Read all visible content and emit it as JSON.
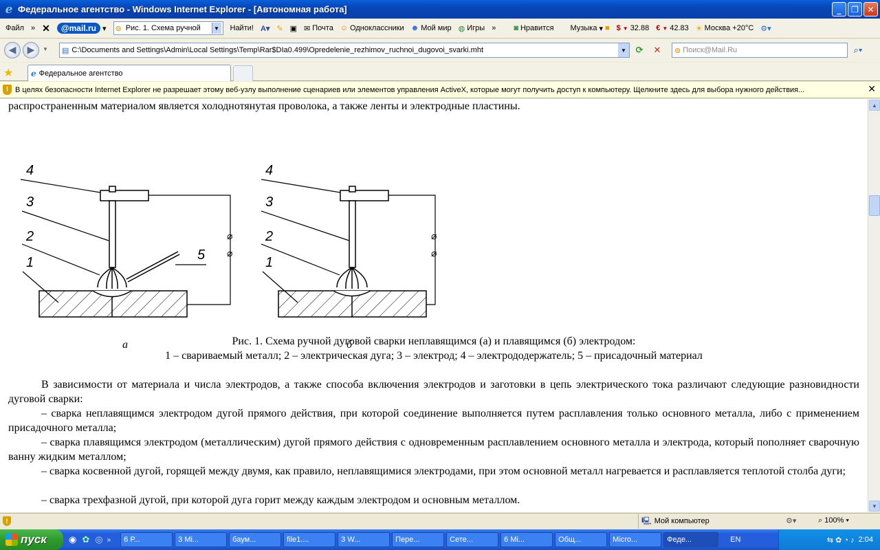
{
  "window": {
    "title": "Федеральное агентство - Windows Internet Explorer - [Автономная работа]"
  },
  "toolbar": {
    "file_menu": "Файл",
    "mailru": "mail.ru",
    "search_combo": "Рис. 1. Схема ручной",
    "find_button": "Найти!",
    "mail": "Почта",
    "odnoklassniki": "Одноклассники",
    "moy_mir": "Мой мир",
    "games": "Игры",
    "like": "Нравится",
    "music": "Музыка",
    "usd": "32.88",
    "eur": "42.83",
    "weather": "Москва +20°C"
  },
  "address": {
    "url": "C:\\Documents and Settings\\Admin\\Local Settings\\Temp\\Rar$DIa0.499\\Opredelenie_rezhimov_ruchnoi_dugovoi_svarki.mht",
    "search_placeholder": "Поиск@Mail.Ru"
  },
  "tabs": [
    {
      "label": "Федеральное агентство"
    }
  ],
  "infobar": {
    "text": "В целях безопасности Internet Explorer не разрешает этому веб-узлу выполнение сценариев или элементов управления ActiveX, которые могут получить доступ к компьютеру. Щелкните здесь для выбора нужного действия..."
  },
  "document": {
    "intro": "распространенным материалом является холоднотянутая проволока, а также ленты и электродные пластины.",
    "figure": {
      "labels": [
        "1",
        "2",
        "3",
        "4",
        "5"
      ],
      "sub_a": "а",
      "sub_b": "б"
    },
    "caption_line1": "Рис. 1. Схема ручной дуговой сварки неплавящимся (а) и плавящимся (б) электродом:",
    "caption_line2": "1 – свариваемый металл; 2 – электрическая дуга; 3 – электрод; 4 – электрододержатель; 5 – присадочный материал",
    "paragraphs": [
      "В зависимости от материала и числа электродов, а также способа включения электродов и заготовки в цепь электрического тока различают следующие разновидности дуговой сварки:",
      "– сварка неплавящимся электродом дугой прямого действия, при которой соединение выполняется путем расплавления только основного металла, либо с применением присадочного металла;",
      "– сварка плавящимся электродом (металлическим) дугой прямого действия с одновременным расплавлением основного металла и электрода, который пополняет сварочную ванну жидким металлом;",
      "– сварка косвенной дугой, горящей между двумя, как правило, неплавящимися электродами, при этом основной металл нагревается и расплавляется теплотой столба дуги;",
      "– сварка трехфазной дугой, при которой дуга горит между каждым электродом и основным металлом."
    ]
  },
  "status": {
    "zone": "Мой компьютер",
    "zoom": "100%"
  },
  "taskbar": {
    "start": "пуск",
    "buttons": [
      "6 Р...",
      "3 Mi...",
      "баум...",
      "file1....",
      "3 W...",
      "Пере...",
      "Сете...",
      "6 Mi...",
      "Общ...",
      "Micro...",
      "Феде..."
    ],
    "lang": "EN",
    "clock": "2:04"
  }
}
